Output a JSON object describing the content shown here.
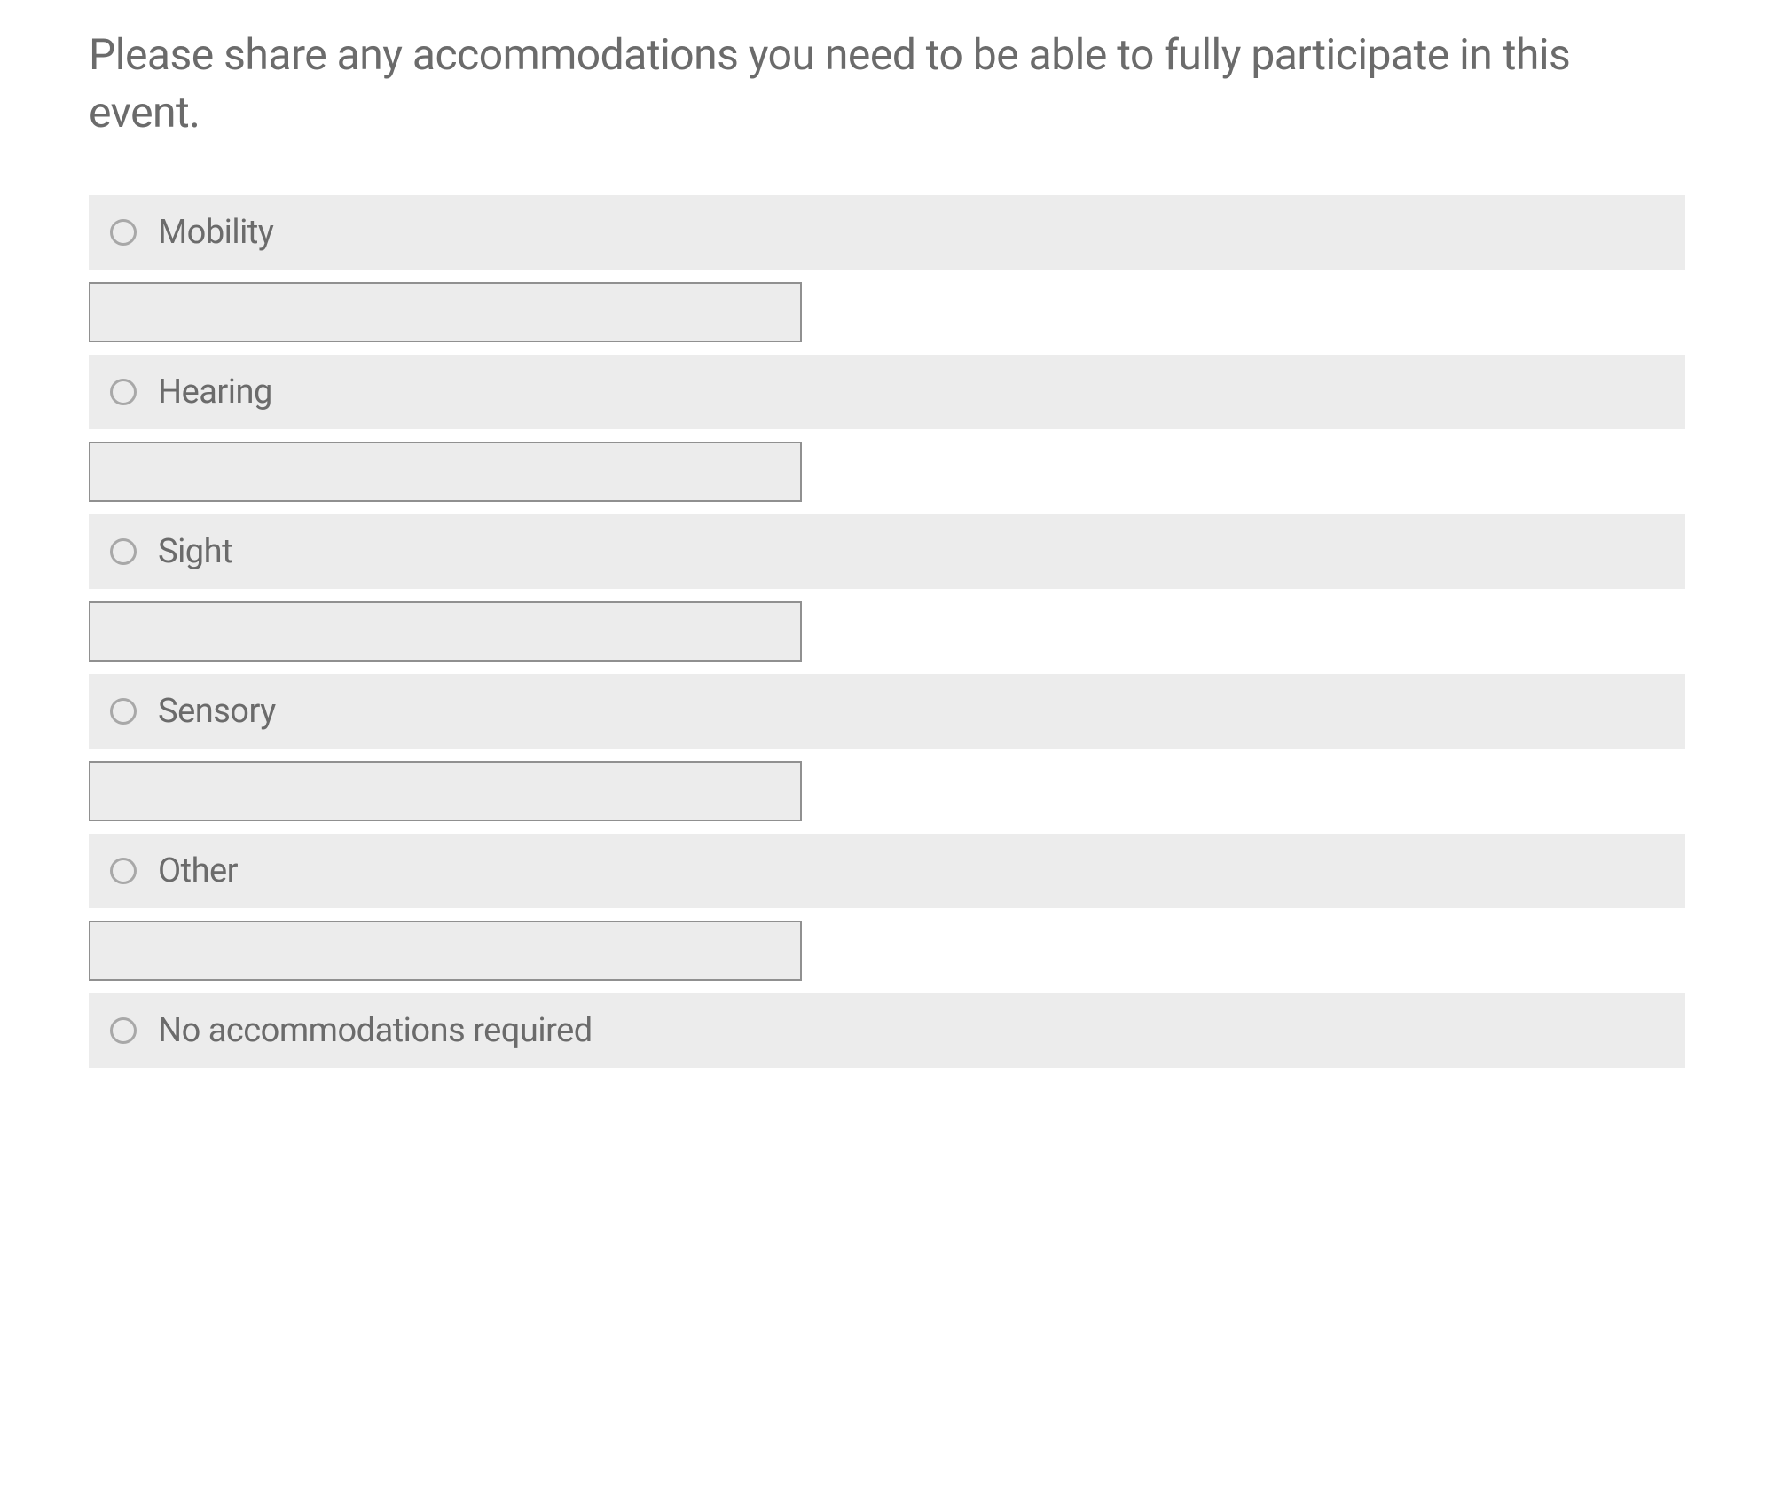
{
  "question": "Please share any accommodations you need to be able to fully participate in this event.",
  "options": [
    {
      "label": "Mobility",
      "has_input": true,
      "input_value": ""
    },
    {
      "label": "Hearing",
      "has_input": true,
      "input_value": ""
    },
    {
      "label": "Sight",
      "has_input": true,
      "input_value": ""
    },
    {
      "label": "Sensory",
      "has_input": true,
      "input_value": ""
    },
    {
      "label": "Other",
      "has_input": true,
      "input_value": ""
    },
    {
      "label": "No accommodations required",
      "has_input": false
    }
  ]
}
